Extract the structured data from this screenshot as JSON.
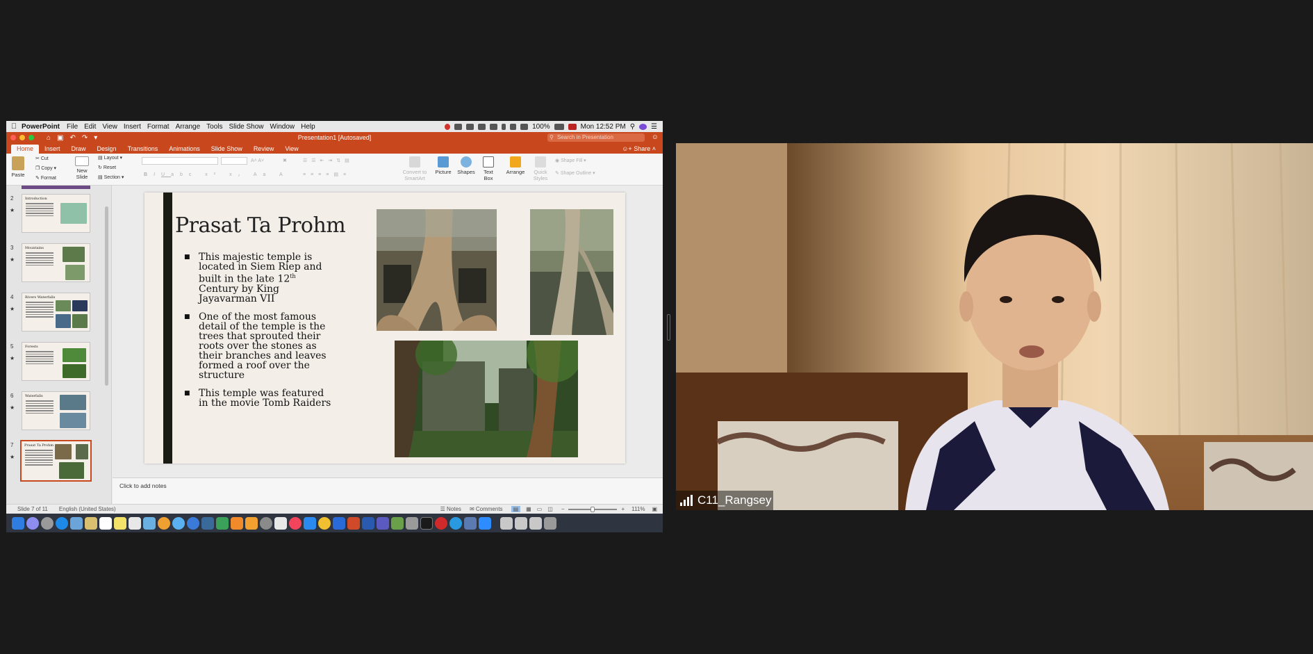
{
  "menubar": {
    "app": "PowerPoint",
    "items": [
      "File",
      "Edit",
      "View",
      "Insert",
      "Format",
      "Arrange",
      "Tools",
      "Slide Show",
      "Window",
      "Help"
    ],
    "battery": "100%",
    "datetime": "Mon 12:52 PM"
  },
  "window": {
    "title": "Presentation1 [Autosaved]",
    "search_placeholder": "Search in Presentation",
    "share_label": "Share"
  },
  "tabs": [
    "Home",
    "Insert",
    "Draw",
    "Design",
    "Transitions",
    "Animations",
    "Slide Show",
    "Review",
    "View"
  ],
  "ribbon": {
    "paste": "Paste",
    "cut": "Cut",
    "copy": "Copy",
    "format": "Format",
    "new_slide_1": "New",
    "new_slide_2": "Slide",
    "layout": "Layout",
    "reset": "Reset",
    "section": "Section",
    "convert_1": "Convert to",
    "convert_2": "SmartArt",
    "picture": "Picture",
    "shapes": "Shapes",
    "textbox_1": "Text",
    "textbox_2": "Box",
    "arrange": "Arrange",
    "quick_1": "Quick",
    "quick_2": "Styles",
    "shape_fill": "Shape Fill",
    "shape_outline": "Shape Outline"
  },
  "thumbnails": [
    {
      "num": "2",
      "title": "Introduction"
    },
    {
      "num": "3",
      "title": "Mountains"
    },
    {
      "num": "4",
      "title": "Rivers Waterfalls"
    },
    {
      "num": "5",
      "title": "Forests"
    },
    {
      "num": "6",
      "title": "Waterfalls"
    },
    {
      "num": "7",
      "title": "Prasat Ta Prohm"
    }
  ],
  "slide": {
    "title": "Prasat Ta Prohm",
    "bullet1_a": "This majestic temple is located in Siem Riep and built in the late 12",
    "bullet1_sup": "th",
    "bullet1_b": " Century by King Jayavarman VII",
    "bullet2": "One of the most famous detail of the temple is the trees that sprouted their roots over the stones as their branches and leaves formed a roof over the structure",
    "bullet3": "This temple was featured in the movie Tomb Raiders"
  },
  "notes_placeholder": "Click to add notes",
  "status": {
    "slide": "Slide 7 of 11",
    "language": "English (United States)",
    "notes": "Notes",
    "comments": "Comments",
    "zoom": "111%"
  },
  "participant": {
    "name": "C11_Rangsey"
  }
}
